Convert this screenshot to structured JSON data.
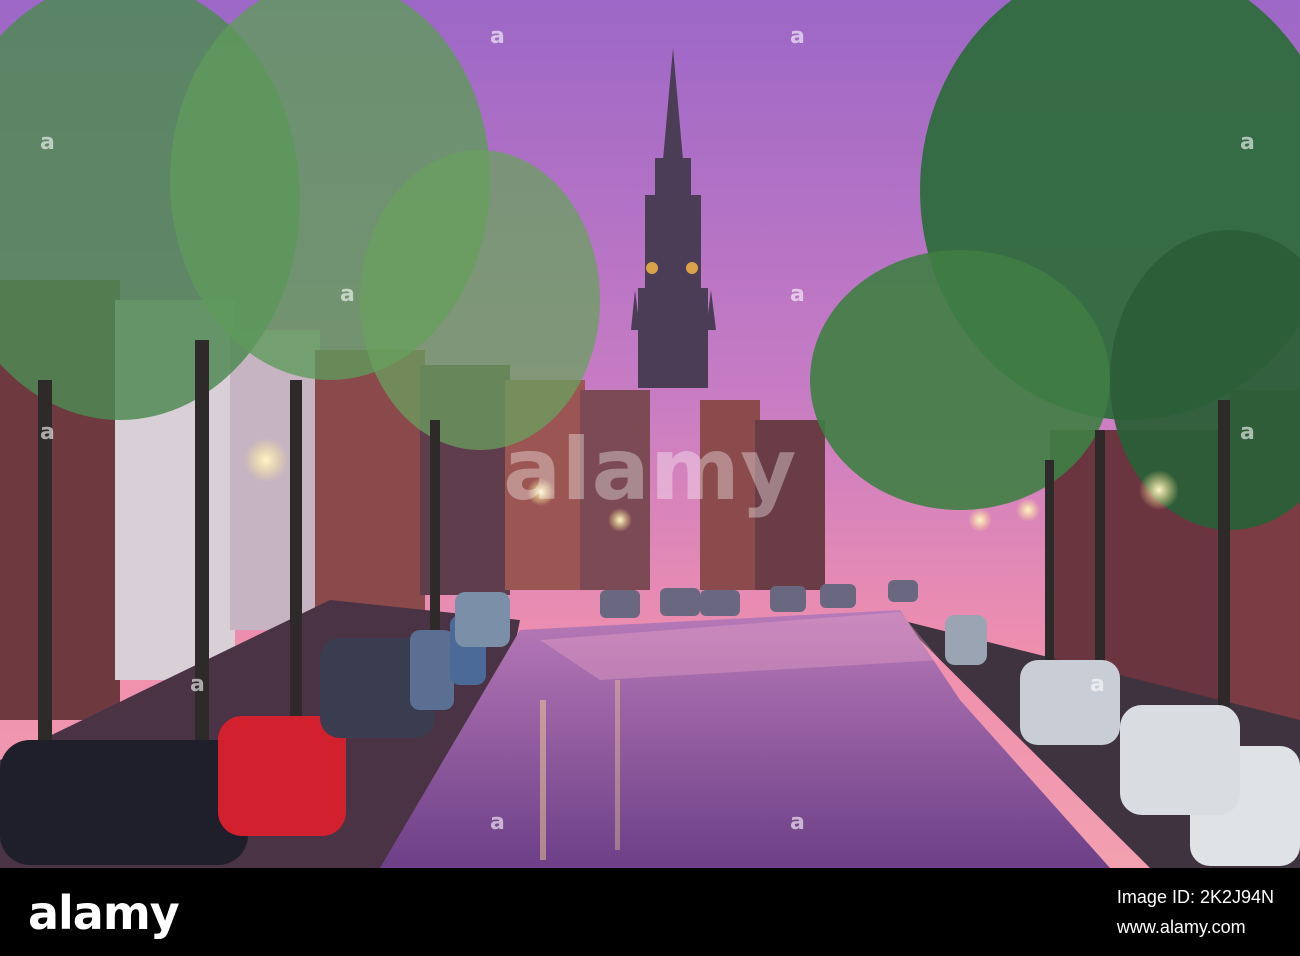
{
  "watermark": {
    "center_text": "alamy",
    "repeat_text": "a"
  },
  "footer": {
    "logo": "alamy",
    "image_id_line": "Image ID: 2K2J94N",
    "url_line": "www.alamy.com"
  },
  "colors": {
    "sky_top": "#b06fc0",
    "sky_bottom": "#f08ab0",
    "canal": "#8e5fa6",
    "footer_bg": "#000000"
  }
}
